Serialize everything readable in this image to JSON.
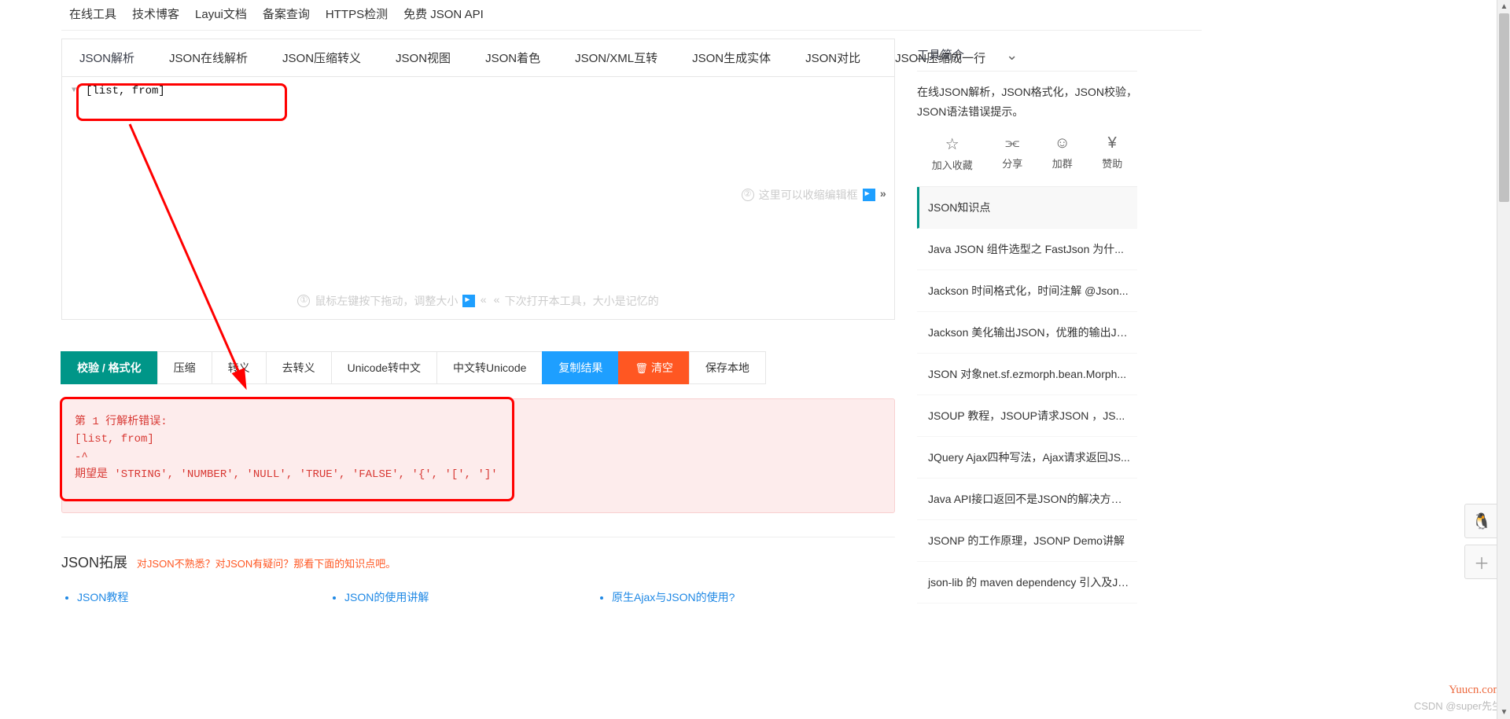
{
  "topnav": [
    "在线工具",
    "技术博客",
    "Layui文档",
    "备案查询",
    "HTTPS检测",
    "免费 JSON API"
  ],
  "tabs": [
    "JSON解析",
    "JSON在线解析",
    "JSON压缩转义",
    "JSON视图",
    "JSON着色",
    "JSON/XML互转",
    "JSON生成实体",
    "JSON对比",
    "JSON压缩成一行"
  ],
  "editor": {
    "content": "[list, from]",
    "hint_collapse": "这里可以收缩编辑框",
    "hint_collapse_num": "②",
    "hint_resize_left": "鼠标左键按下拖动，调整大小",
    "hint_resize_left_num": "①",
    "hint_resize_right": "下次打开本工具，大小是记忆的"
  },
  "toolbar": {
    "validate": "校验 / 格式化",
    "compress": "压缩",
    "escape": "转义",
    "unescape": "去转义",
    "uni2cn": "Unicode转中文",
    "cn2uni": "中文转Unicode",
    "copy": "复制结果",
    "clear": "清空",
    "save": "保存本地"
  },
  "error_text": "第 1 行解析错误:\n[list, from]\n-^\n期望是 'STRING', 'NUMBER', 'NULL', 'TRUE', 'FALSE', '{', '[', ']'",
  "extension": {
    "title": "JSON拓展",
    "subtitle": "对JSON不熟悉？对JSON有疑问？那看下面的知识点吧。",
    "links": [
      "JSON教程",
      "JSON的使用讲解",
      "原生Ajax与JSON的使用?"
    ]
  },
  "sidebar": {
    "intro_title": "工具简介",
    "intro_desc": "在线JSON解析，JSON格式化，JSON校验，JSON语法错误提示。",
    "actions": {
      "fav": "加入收藏",
      "share": "分享",
      "group": "加群",
      "donate": "赞助"
    },
    "items": [
      "JSON知识点",
      "Java JSON 组件选型之 FastJson 为什...",
      "Jackson 时间格式化，时间注解 @Json...",
      "Jackson 美化输出JSON，优雅的输出JS...",
      "JSON 对象net.sf.ezmorph.bean.Morph...",
      "JSOUP 教程，JSOUP请求JSON ，JS...",
      "JQuery Ajax四种写法，Ajax请求返回JS...",
      "Java API接口返回不是JSON的解决方案...",
      "JSONP 的工作原理，JSONP Demo讲解",
      "json-lib 的 maven dependency 引入及Ja..."
    ]
  },
  "watermarks": {
    "site": "Yuucn.com",
    "csdn": "CSDN @super先生"
  }
}
